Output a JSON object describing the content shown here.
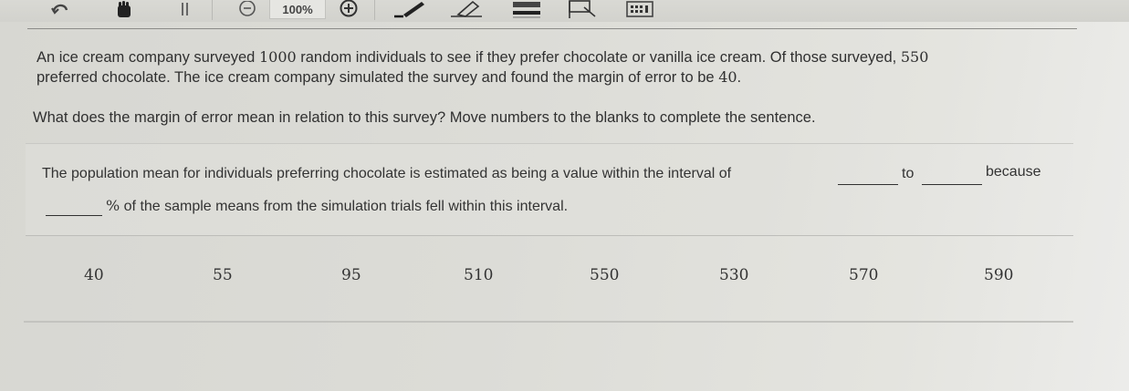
{
  "toolbar": {
    "zoom_level": "100%",
    "icons": [
      "undo-icon",
      "hand-icon",
      "pause-icon",
      "zoom-out-icon",
      "zoom-in-icon",
      "pen-icon",
      "eraser-icon",
      "highlighter-icon",
      "flag-icon",
      "calculator-icon"
    ]
  },
  "question": {
    "line1_a": "An ice cream company surveyed ",
    "n_surveyed": "1000",
    "line1_b": " random individuals to see if they prefer chocolate or vanilla ice cream. Of those surveyed, ",
    "n_chocolate": "550",
    "line2_a": "preferred chocolate. The ice cream company simulated the survey and found the margin of error to be ",
    "margin": "40",
    "line2_b": ".",
    "instruction": "What does the margin of error mean in relation to this survey? Move numbers to the blanks to complete the sentence."
  },
  "sentence": {
    "part1": "The population mean for individuals preferring chocolate is estimated as being a value within the interval of",
    "to": "to",
    "because": "because",
    "percent_sign": "%",
    "part2": " of the sample means from the simulation trials fell within this interval."
  },
  "number_bank": [
    "40",
    "55",
    "95",
    "510",
    "550",
    "530",
    "570",
    "590"
  ]
}
